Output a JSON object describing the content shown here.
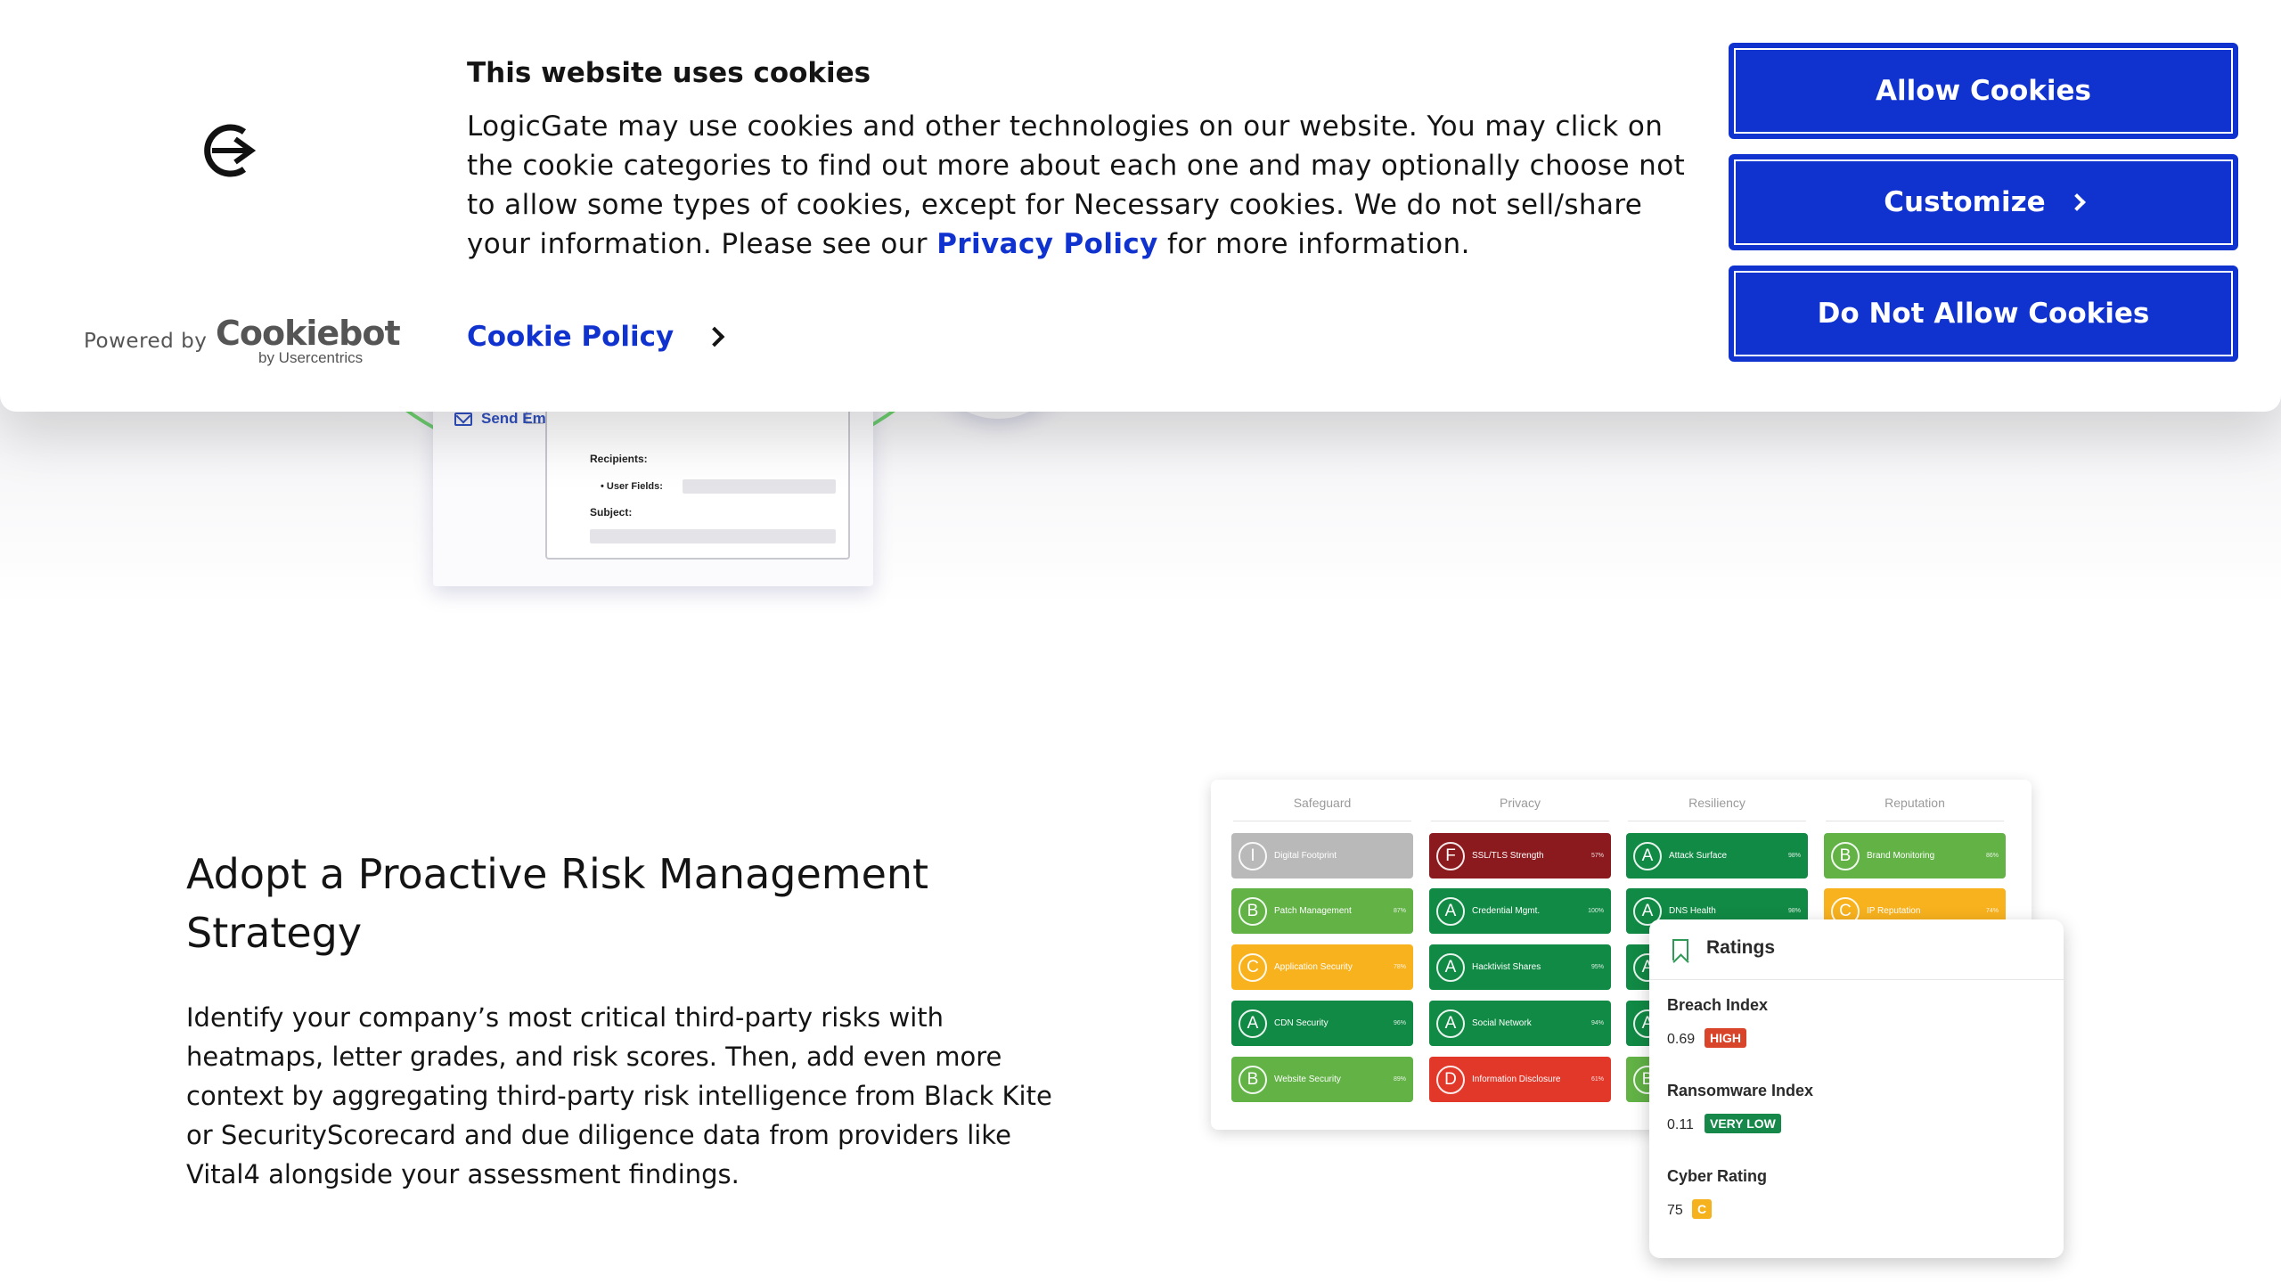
{
  "cookie_banner": {
    "title": "This website uses cookies",
    "text_before_link": "LogicGate may use cookies and other technologies on our website. You may click on the cookie categories to find out more about each one and may optionally choose not to allow some types of cookies, except for Necessary cookies.  We do not sell/share your information. Please see our ",
    "privacy_link": "Privacy Policy",
    "text_after_link": " for more information.",
    "cookie_policy_link": "Cookie Policy",
    "powered_by": "Powered by",
    "cookiebot_brand": "Cookiebot",
    "cookiebot_sub": "by Usercentrics",
    "buttons": {
      "allow": "Allow Cookies",
      "customize": "Customize",
      "deny": "Do Not Allow Cookies"
    },
    "accent_color": "#1032cf"
  },
  "workflow_image": {
    "action": "Send Email",
    "recipients_label": "Recipients:",
    "user_fields_label": "• User Fields:",
    "subject_label": "Subject:"
  },
  "section": {
    "title": "Adopt a Proactive Risk Management Strategy",
    "body": "Identify your company’s most critical third-party risks with heatmaps, letter grades, and risk scores. Then, add even more context by aggregating third-party risk intelligence from Black Kite or SecurityScorecard and due diligence data from providers like Vital4 alongside your assessment findings."
  },
  "ratings_image": {
    "columns": [
      {
        "header": "Safeguard",
        "tiles": [
          {
            "grade": "I",
            "name": "Digital Footprint",
            "pct": "",
            "color": "#b9b9b9"
          },
          {
            "grade": "B",
            "name": "Patch Management",
            "pct": "87%",
            "color": "#62b246"
          },
          {
            "grade": "C",
            "name": "Application Security",
            "pct": "78%",
            "color": "#f8b21e"
          },
          {
            "grade": "A",
            "name": "CDN Security",
            "pct": "96%",
            "color": "#118a45"
          },
          {
            "grade": "B",
            "name": "Website Security",
            "pct": "89%",
            "color": "#62b246"
          }
        ]
      },
      {
        "header": "Privacy",
        "tiles": [
          {
            "grade": "F",
            "name": "SSL/TLS Strength",
            "pct": "57%",
            "color": "#8b1a1e"
          },
          {
            "grade": "A",
            "name": "Credential Mgmt.",
            "pct": "100%",
            "color": "#118a45"
          },
          {
            "grade": "A",
            "name": "Hacktivist Shares",
            "pct": "95%",
            "color": "#118a45"
          },
          {
            "grade": "A",
            "name": "Social Network",
            "pct": "94%",
            "color": "#118a45"
          },
          {
            "grade": "D",
            "name": "Information Disclosure",
            "pct": "61%",
            "color": "#e1382a"
          }
        ]
      },
      {
        "header": "Resiliency",
        "tiles": [
          {
            "grade": "A",
            "name": "Attack Surface",
            "pct": "98%",
            "color": "#118a45"
          },
          {
            "grade": "A",
            "name": "DNS Health",
            "pct": "98%",
            "color": "#118a45"
          },
          {
            "grade": "A",
            "name": "",
            "pct": "",
            "color": "#118a45"
          },
          {
            "grade": "A",
            "name": "",
            "pct": "",
            "color": "#118a45"
          },
          {
            "grade": "B",
            "name": "",
            "pct": "",
            "color": "#62b246"
          }
        ]
      },
      {
        "header": "Reputation",
        "tiles": [
          {
            "grade": "B",
            "name": "Brand Monitoring",
            "pct": "86%",
            "color": "#62b246"
          },
          {
            "grade": "C",
            "name": "IP Reputation",
            "pct": "74%",
            "color": "#f8b21e"
          }
        ]
      }
    ],
    "popup": {
      "title": "Ratings",
      "metrics": [
        {
          "label": "Breach Index",
          "value": "0.69",
          "badge": "HIGH",
          "badge_color": "#d9452b"
        },
        {
          "label": "Ransomware Index",
          "value": "0.11",
          "badge": "VERY LOW",
          "badge_color": "#16884a"
        },
        {
          "label": "Cyber Rating",
          "value": "75",
          "badge": "C",
          "badge_color": "#f5b21c"
        }
      ]
    }
  }
}
